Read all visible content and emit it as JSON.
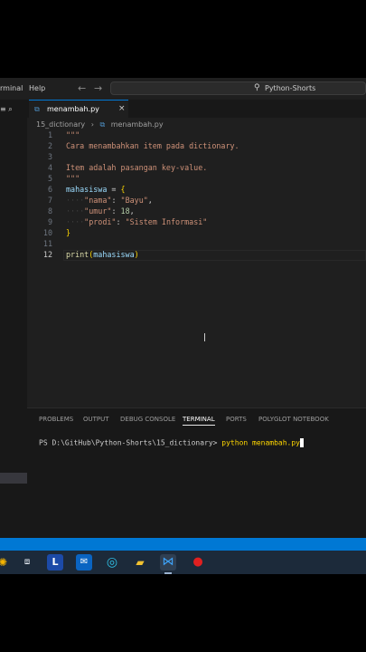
{
  "menubar": {
    "terminal_label": "rminal",
    "help_label": "Help",
    "back_icon": "arrow-left-icon",
    "forward_icon": "arrow-right-icon"
  },
  "search": {
    "icon": "search-icon",
    "text": "Python-Shorts"
  },
  "tab": {
    "label": "menambah.py",
    "icon": "python-file-icon",
    "close_icon": "close-icon"
  },
  "breadcrumb": {
    "folder": "15_dictionary",
    "separator": "›",
    "file": "menambah.py"
  },
  "editor": {
    "active_line": "12",
    "lines": [
      {
        "n": "1"
      },
      {
        "n": "2"
      },
      {
        "n": "3"
      },
      {
        "n": "4"
      },
      {
        "n": "5"
      },
      {
        "n": "6"
      },
      {
        "n": "7"
      },
      {
        "n": "8"
      },
      {
        "n": "9"
      },
      {
        "n": "10"
      },
      {
        "n": "11"
      },
      {
        "n": "12"
      }
    ],
    "code": {
      "l1": "\"\"\"",
      "l2": "Cara menambahkan item pada dictionary.",
      "l4": "Item adalah pasangan key-value.",
      "l5": "\"\"\"",
      "l6_var": "mahasiswa",
      "l6_op": " = ",
      "l6_brace": "{",
      "indent": "····",
      "l7_key": "\"nama\"",
      "l7_colon": ": ",
      "l7_val": "\"Bayu\"",
      "l7_comma": ",",
      "l8_key": "\"umur\"",
      "l8_colon": ": ",
      "l8_val": "18",
      "l8_comma": ",",
      "l9_key": "\"prodi\"",
      "l9_colon": ": ",
      "l9_val": "\"Sistem Informasi\"",
      "l10_brace": "}",
      "l12_fn": "print",
      "l12_open": "(",
      "l12_arg": "mahasiswa",
      "l12_close": ")"
    }
  },
  "panel": {
    "tabs": [
      "PROBLEMS",
      "OUTPUT",
      "DEBUG CONSOLE",
      "TERMINAL",
      "PORTS",
      "POLYGLOT NOTEBOOK"
    ],
    "active_tab": "TERMINAL",
    "prompt": "PS D:\\GitHub\\Python-Shorts\\15_dictionary> ",
    "command": "python menambah.py"
  },
  "taskbar": {
    "icons": [
      "weather-icon",
      "task-view-icon",
      "l-app-icon",
      "outlook-icon",
      "edge-icon",
      "file-explorer-icon",
      "vscode-icon",
      "app-red-icon"
    ]
  },
  "colors": {
    "editor_bg": "#1f1f1f",
    "accent": "#0078d4",
    "string": "#ce9178",
    "variable": "#9cdcfe",
    "number": "#b5cea8"
  }
}
